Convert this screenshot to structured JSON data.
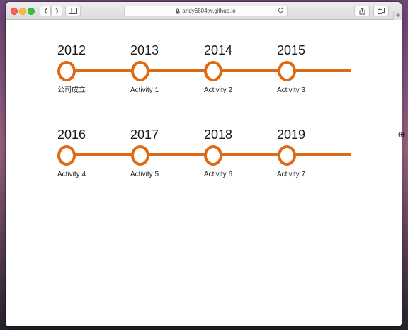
{
  "browser": {
    "url": "andy6804tw.github.io",
    "new_tab": "+"
  },
  "colors": {
    "accent": "#df6a12",
    "text": "#1a1a1a"
  },
  "timeline": {
    "rows": [
      [
        {
          "year": "2012",
          "label": "公司成立"
        },
        {
          "year": "2013",
          "label": "Activity 1"
        },
        {
          "year": "2014",
          "label": "Activity 2"
        },
        {
          "year": "2015",
          "label": "Activity 3"
        }
      ],
      [
        {
          "year": "2016",
          "label": "Activity 4"
        },
        {
          "year": "2017",
          "label": "Activity 5"
        },
        {
          "year": "2018",
          "label": "Activity 6"
        },
        {
          "year": "2019",
          "label": "Activity 7"
        }
      ]
    ]
  }
}
